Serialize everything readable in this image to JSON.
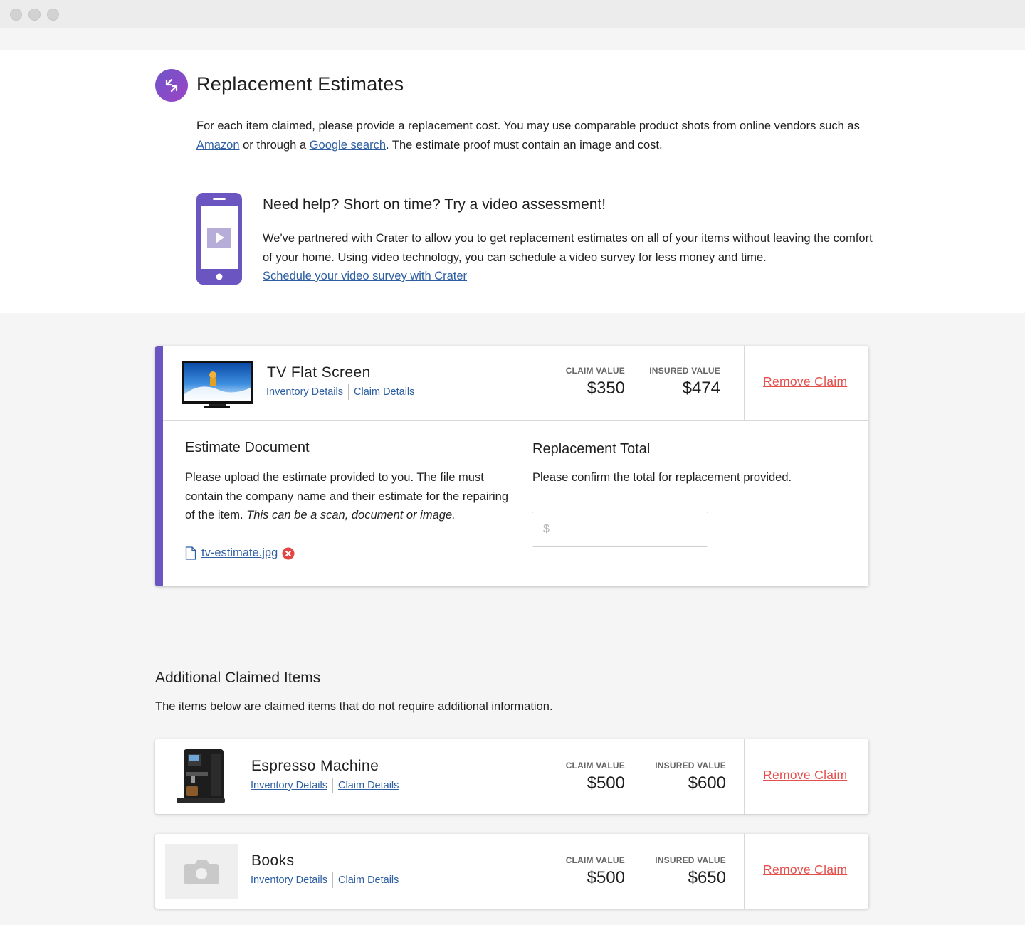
{
  "header": {
    "title": "Replacement Estimates",
    "intro_prefix": "For each item claimed, please provide a replacement cost. You may use comparable product shots from online vendors such as ",
    "amazon_link": "Amazon",
    "intro_middle": " or through a ",
    "google_link": "Google search",
    "intro_suffix": ". The estimate proof must contain an image and cost."
  },
  "help": {
    "title": "Need help? Short on time? Try a video assessment!",
    "body": "We've partnered with Crater to allow you to get replacement estimates on all of your items without leaving the comfort of your home. Using video technology, you can schedule a video survey for less money and time.",
    "link": "Schedule your video survey with Crater"
  },
  "main_item": {
    "name": "TV Flat Screen",
    "inventory_link": "Inventory Details",
    "claim_link": "Claim Details",
    "claim_value_label": "CLAIM VALUE",
    "claim_value": "$350",
    "insured_value_label": "INSURED VALUE",
    "insured_value": "$474",
    "remove_label": "Remove Claim",
    "estimate_title": "Estimate Document",
    "estimate_body": "Please upload the estimate provided to you. The file must contain the company name and their estimate for the repairing of the item. ",
    "estimate_body_italic": "This can be a scan, document or image.",
    "file_name": "tv-estimate.jpg",
    "replacement_title": "Replacement Total",
    "replacement_body": "Please confirm the total for replacement provided.",
    "replacement_placeholder": "$"
  },
  "additional": {
    "title": "Additional Claimed Items",
    "body": "The items below are claimed items that do not require additional information.",
    "items": [
      {
        "name": "Espresso Machine",
        "inventory_link": "Inventory Details",
        "claim_link": "Claim Details",
        "claim_value_label": "CLAIM VALUE",
        "claim_value": "$500",
        "insured_value_label": "INSURED VALUE",
        "insured_value": "$600",
        "remove_label": "Remove Claim"
      },
      {
        "name": "Books",
        "inventory_link": "Inventory Details",
        "claim_link": "Claim Details",
        "claim_value_label": "CLAIM VALUE",
        "claim_value": "$500",
        "insured_value_label": "INSURED VALUE",
        "insured_value": "$650",
        "remove_label": "Remove Claim"
      }
    ]
  },
  "colors": {
    "accent": "#6b56c1",
    "link": "#2e5fa3",
    "danger": "#e4504e"
  },
  "icons": [
    "window-close-dot",
    "window-minimize-dot",
    "window-maximize-dot",
    "swap-arrows-icon",
    "phone-video-icon",
    "file-icon",
    "remove-file-icon",
    "tv-thumbnail",
    "espresso-thumbnail",
    "camera-placeholder-icon"
  ]
}
